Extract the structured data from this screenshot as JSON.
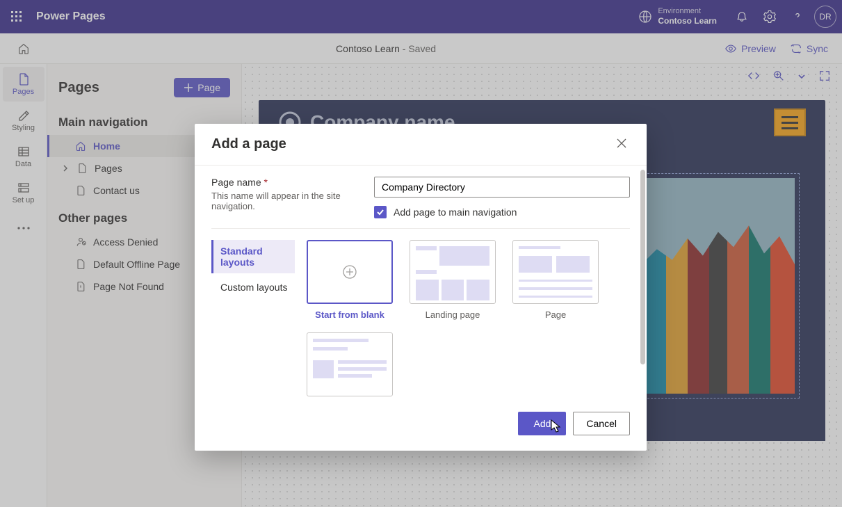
{
  "topbar": {
    "app_name": "Power Pages",
    "env_label": "Environment",
    "env_name": "Contoso Learn",
    "avatar_initials": "DR"
  },
  "secondbar": {
    "site_name": "Contoso Learn",
    "save_state": " - Saved",
    "preview": "Preview",
    "sync": "Sync"
  },
  "rail": {
    "pages": "Pages",
    "styling": "Styling",
    "data": "Data",
    "setup": "Set up"
  },
  "panel": {
    "title": "Pages",
    "add_btn": "Page",
    "section_main": "Main navigation",
    "section_other": "Other pages",
    "main_items": {
      "home": "Home",
      "pages": "Pages",
      "contact": "Contact us"
    },
    "other_items": {
      "access_denied": "Access Denied",
      "default_offline": "Default Offline Page",
      "not_found": "Page Not Found"
    }
  },
  "canvas": {
    "site_company": "Company name"
  },
  "modal": {
    "title": "Add a page",
    "page_name_label": "Page name",
    "page_name_hint": "This name will appear in the site navigation.",
    "page_name_value": "Company Directory",
    "add_to_nav": "Add page to main navigation",
    "tabs": {
      "standard": "Standard layouts",
      "custom": "Custom layouts"
    },
    "layouts": {
      "blank": "Start from blank",
      "landing": "Landing page",
      "page": "Page"
    },
    "btn_add": "Add",
    "btn_cancel": "Cancel"
  }
}
